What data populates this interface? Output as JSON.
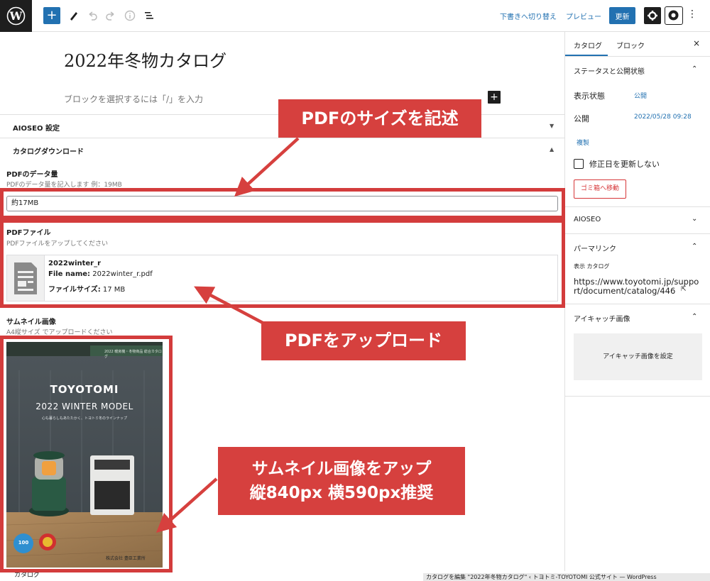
{
  "toolbar": {
    "switch_draft_label": "下書きへ切り替え",
    "preview_label": "プレビュー",
    "update_label": "更新",
    "more_label": "⋮"
  },
  "editor": {
    "title": "2022年冬物カタログ",
    "block_placeholder": "ブロックを選択するには「/」を入力",
    "inserter_label": "+"
  },
  "meta_boxes": [
    {
      "label": "AIOSEO 設定",
      "arrow": "▼"
    },
    {
      "label": "カタログダウンロード",
      "arrow": "▲"
    }
  ],
  "fields": {
    "size": {
      "label": "PDFのデータ量",
      "description": "PDFのデータ量を記入します 例：19MB",
      "value": "約17MB"
    },
    "pdf": {
      "label": "PDFファイル",
      "description": "PDFファイルをアップしてください",
      "file_title": "2022winter_r",
      "file_name_label": "File name:",
      "file_name_value": "2022winter_r.pdf",
      "file_size_label": "ファイルサイズ:",
      "file_size_value": "17 MB"
    },
    "thumbnail": {
      "label": "サムネイル画像",
      "description": "A4縦サイズ でアップロードください"
    }
  },
  "thumbnail_image": {
    "top_text": "2022 暖房機・冬物商品 総合カタログ",
    "brand": "TOYOTOMI",
    "model": "2022 WINTER MODEL",
    "tagline": "心も暮らしもあたたかく、トヨトミ冬のラインナップ",
    "badge_number": "100",
    "company": "株式会社 豊臣工業所"
  },
  "sidebar": {
    "tabs": [
      "カタログ",
      "ブロック"
    ],
    "close_label": "×",
    "status_section": {
      "title": "ステータスと公開状態",
      "visibility_label": "表示状態",
      "visibility_value": "公開",
      "publish_label": "公開",
      "publish_value": "2022/05/28 09:28",
      "duplicate_label": "複製",
      "checkbox_label": "修正日を更新しない",
      "trash_label": "ゴミ箱へ移動"
    },
    "aioseo_title": "AIOSEO",
    "permalink": {
      "title": "パーマリンク",
      "view_label": "表示 カタログ",
      "url_line1": "https://www.toyotomi.jp/suppo",
      "url_line2": "rt/document/catalog/446"
    },
    "featured": {
      "title": "アイキャッチ画像",
      "button_label": "アイキャッチ画像を設定"
    }
  },
  "footer": {
    "breadcrumb": "カタログ",
    "status": "カタログを編集 \"2022年冬物カタログ\" ‹ トヨトミ-TOYOTOMI 公式サイト — WordPress"
  },
  "annotations": {
    "size_callout": "PDFのサイズを記述",
    "upload_callout": "PDFをアップロード",
    "thumb_callout_line1": "サムネイル画像をアップ",
    "thumb_callout_line2": "縦840px 横590px推奨",
    "color": "#d6403e"
  },
  "colors": {
    "accent": "#2271b1",
    "dark": "#1e1e1e",
    "annotation": "#d6403e"
  }
}
